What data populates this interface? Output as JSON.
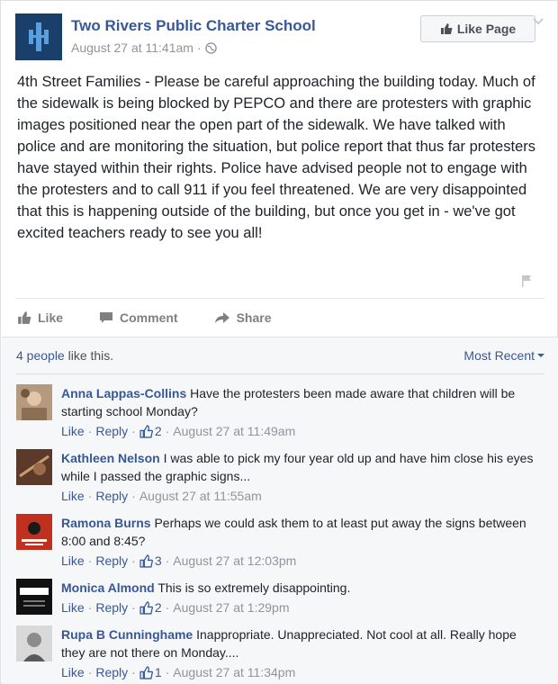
{
  "post": {
    "page_name": "Two Rivers Public Charter School",
    "timestamp": "August 27 at 11:41am",
    "separator": "·",
    "like_page_label": "Like Page",
    "body": "4th Street Families - Please be careful approaching the building today. Much of the sidewalk is being blocked by PEPCO and there are protesters with graphic images positioned near the open part of the sidewalk. We have talked with police and are monitoring the situation, but police report that thus far protesters have stayed within their rights. Police have advised people not to engage with the protesters and to call 911 if you feel threatened. We are very disappointed that this is happening outside of the building, but once you get in - we've got excited teachers ready to see you all!",
    "actions": {
      "like": "Like",
      "comment": "Comment",
      "share": "Share"
    }
  },
  "reactions": {
    "likes_count": "4 people",
    "likes_suffix": " like this.",
    "sort_label": "Most Recent"
  },
  "comments": [
    {
      "author": "Anna Lappas-Collins",
      "text": "Have the protesters been made aware that children will be starting school Monday?",
      "like": "Like",
      "reply": "Reply",
      "reacts": "2",
      "time": "August 27 at 11:49am"
    },
    {
      "author": "Kathleen Nelson",
      "text": "I was able to pick my four year old up and have him close his eyes while I passed the graphic signs...",
      "like": "Like",
      "reply": "Reply",
      "reacts": "",
      "time": "August 27 at 11:55am"
    },
    {
      "author": "Ramona Burns",
      "text": "Perhaps we could ask them to at least put away the signs between 8:00 and 8:45?",
      "like": "Like",
      "reply": "Reply",
      "reacts": "3",
      "time": "August 27 at 12:03pm"
    },
    {
      "author": "Monica Almond",
      "text": "This is so extremely disappointing.",
      "like": "Like",
      "reply": "Reply",
      "reacts": "2",
      "time": "August 27 at 1:29pm"
    },
    {
      "author": "Rupa B Cunninghame",
      "text": "Inappropriate. Unappreciated. Not cool at all. Really hope they are not there on Monday....",
      "like": "Like",
      "reply": "Reply",
      "reacts": "1",
      "time": "August 27 at 11:34pm"
    }
  ],
  "colors": {
    "link": "#365899",
    "meta": "#90949c",
    "text": "#1d2129"
  },
  "icons": [
    "globe-icon",
    "thumbs-up-icon",
    "chevron-down-icon",
    "comment-icon",
    "share-icon",
    "flag-icon"
  ]
}
